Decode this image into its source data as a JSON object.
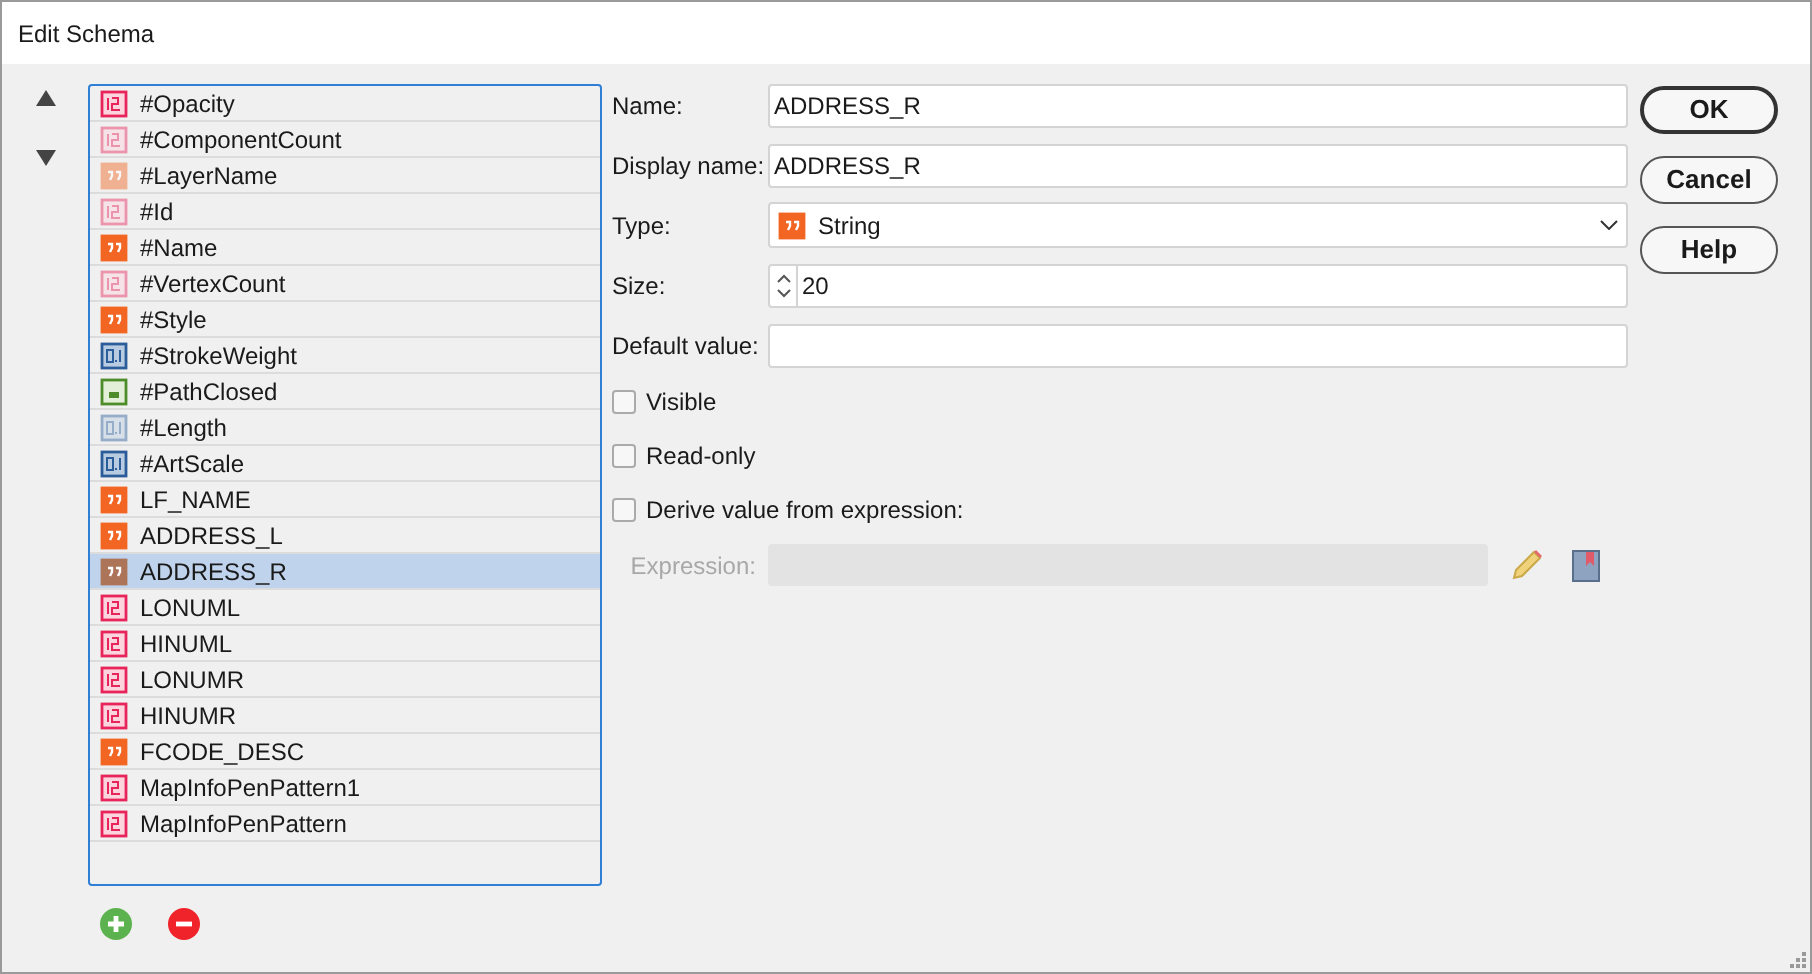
{
  "window": {
    "title": "Edit Schema"
  },
  "fields": [
    {
      "label": "#Opacity",
      "kind": "integer",
      "faded": false,
      "selected": false
    },
    {
      "label": "#ComponentCount",
      "kind": "integer",
      "faded": true,
      "selected": false
    },
    {
      "label": "#LayerName",
      "kind": "string",
      "faded": true,
      "selected": false
    },
    {
      "label": "#Id",
      "kind": "integer",
      "faded": true,
      "selected": false
    },
    {
      "label": "#Name",
      "kind": "string",
      "faded": false,
      "selected": false
    },
    {
      "label": "#VertexCount",
      "kind": "integer",
      "faded": true,
      "selected": false
    },
    {
      "label": "#Style",
      "kind": "string",
      "faded": false,
      "selected": false
    },
    {
      "label": "#StrokeWeight",
      "kind": "real",
      "faded": false,
      "selected": false
    },
    {
      "label": "#PathClosed",
      "kind": "boolean",
      "faded": false,
      "selected": false
    },
    {
      "label": "#Length",
      "kind": "real",
      "faded": true,
      "selected": false
    },
    {
      "label": "#ArtScale",
      "kind": "real",
      "faded": false,
      "selected": false
    },
    {
      "label": "LF_NAME",
      "kind": "string",
      "faded": false,
      "selected": false
    },
    {
      "label": "ADDRESS_L",
      "kind": "string",
      "faded": false,
      "selected": false
    },
    {
      "label": "ADDRESS_R",
      "kind": "string",
      "faded": false,
      "selected": true
    },
    {
      "label": "LONUML",
      "kind": "integer",
      "faded": false,
      "selected": false
    },
    {
      "label": "HINUML",
      "kind": "integer",
      "faded": false,
      "selected": false
    },
    {
      "label": "LONUMR",
      "kind": "integer",
      "faded": false,
      "selected": false
    },
    {
      "label": "HINUMR",
      "kind": "integer",
      "faded": false,
      "selected": false
    },
    {
      "label": "FCODE_DESC",
      "kind": "string",
      "faded": false,
      "selected": false
    },
    {
      "label": "MapInfoPenPattern1",
      "kind": "integer",
      "faded": false,
      "selected": false
    },
    {
      "label": "MapInfoPenPattern",
      "kind": "integer",
      "faded": false,
      "selected": false
    }
  ],
  "form": {
    "name": {
      "label": "Name:",
      "value": "ADDRESS_R"
    },
    "display_name": {
      "label": "Display name:",
      "value": "ADDRESS_R"
    },
    "type": {
      "label": "Type:",
      "value": "String",
      "kind": "string"
    },
    "size": {
      "label": "Size:",
      "value": "20"
    },
    "default_value": {
      "label": "Default value:"
    },
    "checkboxes": [
      {
        "label": "Visible",
        "checked": false
      },
      {
        "label": "Read-only",
        "checked": false
      },
      {
        "label": "Derive value from expression:",
        "checked": false
      }
    ],
    "expression": {
      "label": "Expression:",
      "disabled": true
    }
  },
  "buttons": [
    {
      "label": "OK",
      "default": true
    },
    {
      "label": "Cancel",
      "default": false
    },
    {
      "label": "Help",
      "default": false
    }
  ]
}
